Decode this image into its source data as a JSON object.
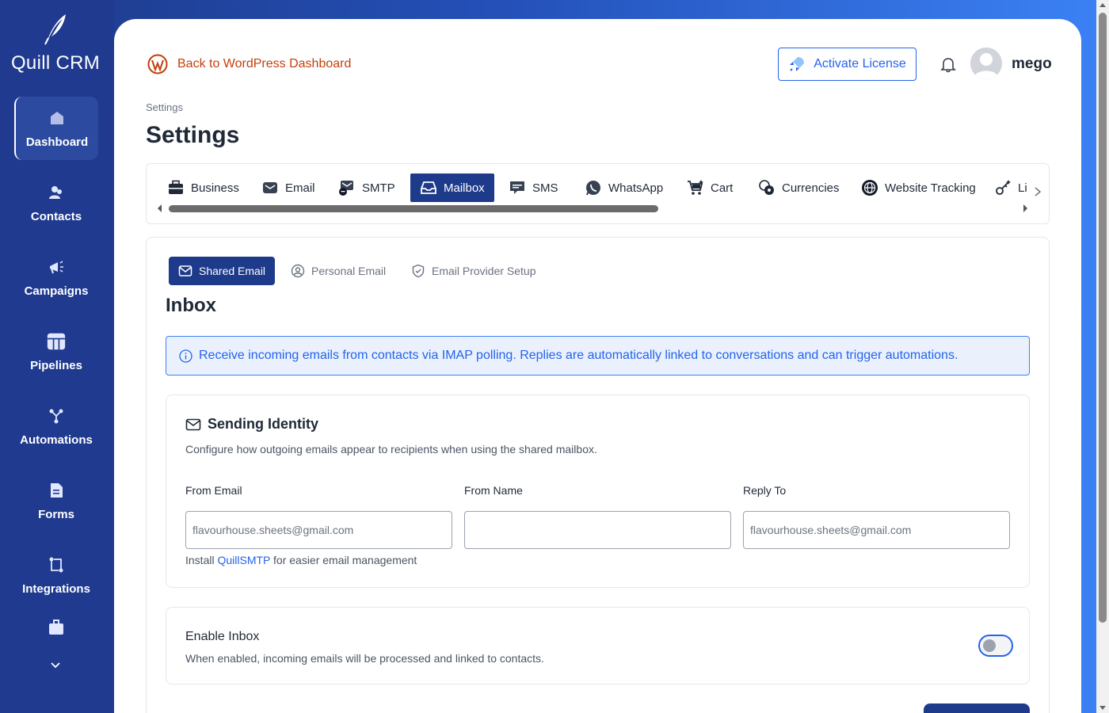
{
  "app": {
    "name": "Quill CRM"
  },
  "sidebar": {
    "items": [
      {
        "label": "Dashboard",
        "icon": "home-icon",
        "active": true
      },
      {
        "label": "Contacts",
        "icon": "users-icon"
      },
      {
        "label": "Campaigns",
        "icon": "megaphone-icon"
      },
      {
        "label": "Pipelines",
        "icon": "pipeline-icon"
      },
      {
        "label": "Automations",
        "icon": "automation-icon"
      },
      {
        "label": "Forms",
        "icon": "form-icon"
      },
      {
        "label": "Integrations",
        "icon": "integrations-icon"
      },
      {
        "label": "",
        "icon": "briefcase-icon"
      }
    ]
  },
  "header": {
    "back_link": "Back to WordPress Dashboard",
    "license_button": "Activate License",
    "username": "mego"
  },
  "breadcrumb": "Settings",
  "page_title": "Settings",
  "settings_tabs": [
    {
      "label": "Business",
      "icon": "briefcase-icon"
    },
    {
      "label": "Email",
      "icon": "envelope-icon"
    },
    {
      "label": "SMTP",
      "icon": "smtp-icon"
    },
    {
      "label": "Mailbox",
      "icon": "inbox-icon",
      "active": true
    },
    {
      "label": "SMS",
      "icon": "message-icon"
    },
    {
      "label": "WhatsApp",
      "icon": "whatsapp-icon"
    },
    {
      "label": "Cart",
      "icon": "cart-icon"
    },
    {
      "label": "Currencies",
      "icon": "coins-icon"
    },
    {
      "label": "Website Tracking",
      "icon": "globe-icon"
    },
    {
      "label": "Li",
      "icon": "license-icon"
    }
  ],
  "sub_tabs": [
    {
      "label": "Shared Email",
      "icon": "envelope-icon",
      "active": true
    },
    {
      "label": "Personal Email",
      "icon": "user-circle-icon"
    },
    {
      "label": "Email Provider Setup",
      "icon": "shield-icon"
    }
  ],
  "inbox": {
    "title": "Inbox",
    "info": "Receive incoming emails from contacts via IMAP polling. Replies are automatically linked to conversations and can trigger automations."
  },
  "sending_identity": {
    "title": "Sending Identity",
    "description": "Configure how outgoing emails appear to recipients when using the shared mailbox.",
    "fields": {
      "from_email": {
        "label": "From Email",
        "value": "",
        "placeholder": "flavourhouse.sheets@gmail.com"
      },
      "from_name": {
        "label": "From Name",
        "value": "",
        "placeholder": ""
      },
      "reply_to": {
        "label": "Reply To",
        "value": "",
        "placeholder": "flavourhouse.sheets@gmail.com"
      }
    },
    "install_prefix": "Install",
    "install_link": "QuillSMTP",
    "install_suffix": "for easier email management"
  },
  "enable_inbox": {
    "title": "Enable Inbox",
    "description": "When enabled, incoming emails will be processed and linked to contacts.",
    "enabled": false
  },
  "colors": {
    "sidebar_bg": "#1f3a8f",
    "accent": "#1e3a8a",
    "link": "#2563eb",
    "wp_orange": "#c2410c"
  }
}
